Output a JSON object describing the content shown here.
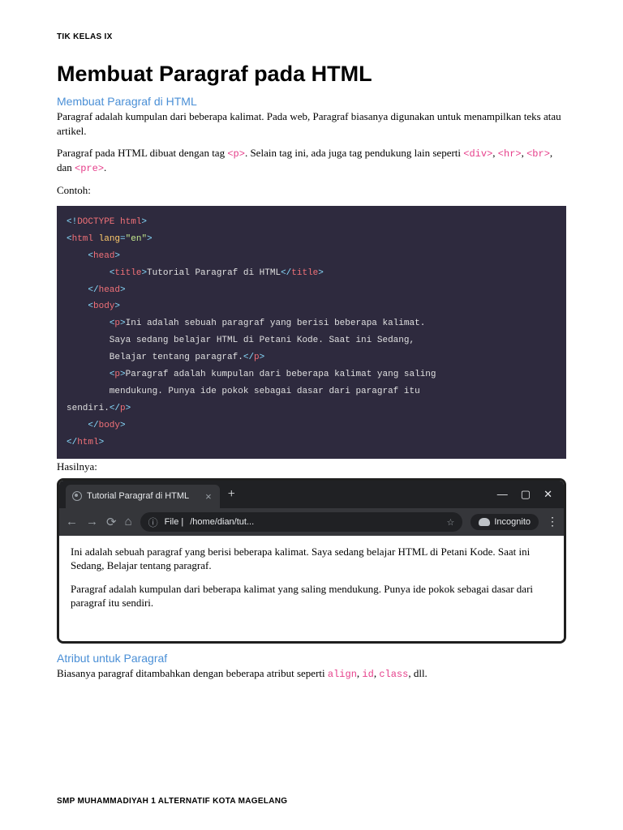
{
  "header": {
    "label": "TIK KELAS IX"
  },
  "title": "Membuat Paragraf pada HTML",
  "section1": {
    "heading": "Membuat Paragraf di HTML",
    "p1": "Paragraf adalah kumpulan dari beberapa kalimat. Pada web, Paragraf biasanya digunakan untuk menampilkan teks atau artikel.",
    "p2_pre": "Paragraf pada HTML dibuat dengan tag ",
    "p2_tag": "<p>",
    "p2_mid": ". Selain tag ini, ada juga tag pendukung lain seperti ",
    "p2_tags": [
      "<div>",
      "<hr>",
      "<br>",
      "<pre>"
    ],
    "p2_sep": ", ",
    "p2_and": ", dan ",
    "p2_post": ".",
    "example_label": "Contoh:"
  },
  "code": {
    "line1_open": "<!DOCTYPE html>",
    "html_open": "html",
    "lang_attr": "lang",
    "lang_val": "\"en\"",
    "head": "head",
    "title_tag": "title",
    "title_text": "Tutorial Paragraf di HTML",
    "body": "body",
    "p": "p",
    "para1": "Ini adalah sebuah paragraf yang berisi beberapa kalimat. Saya sedang belajar HTML di Petani Kode. Saat ini Sedang, Belajar tentang paragraf.",
    "para2": "Paragraf adalah kumpulan dari beberapa kalimat yang saling mendukung. Punya ide pokok sebagai dasar dari paragraf itu sendiri."
  },
  "result_label": "Hasilnya:",
  "browser": {
    "tab_title": "Tutorial Paragraf di HTML",
    "url_prefix": "File |",
    "url_path": "/home/dian/tut...",
    "incognito": "Incognito",
    "content_p1": "Ini adalah sebuah paragraf yang berisi beberapa kalimat. Saya sedang belajar HTML di Petani Kode. Saat ini Sedang, Belajar tentang paragraf.",
    "content_p2": "Paragraf adalah kumpulan dari beberapa kalimat yang saling mendukung. Punya ide pokok sebagai dasar dari paragraf itu sendiri."
  },
  "section2": {
    "heading": "Atribut untuk Paragraf",
    "p1_pre": "Biasanya paragraf ditambahkan dengan beberapa atribut seperti ",
    "attrs": [
      "align",
      "id",
      "class"
    ],
    "p1_post": ", dll."
  },
  "footer": {
    "label": "SMP MUHAMMADIYAH 1 ALTERNATIF KOTA MAGELANG"
  }
}
